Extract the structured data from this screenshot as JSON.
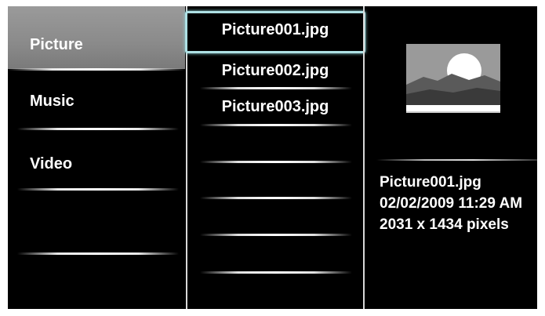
{
  "menu": {
    "items": [
      {
        "label": "Picture",
        "selected": true
      },
      {
        "label": "Music",
        "selected": false
      },
      {
        "label": "Video",
        "selected": false
      }
    ]
  },
  "files": {
    "items": [
      {
        "label": "Picture001.jpg",
        "focused": true
      },
      {
        "label": "Picture002.jpg",
        "focused": false
      },
      {
        "label": "Picture003.jpg",
        "focused": false
      }
    ]
  },
  "preview": {
    "thumbnail_icon": "landscape-thumbnail-icon",
    "filename": "Picture001.jpg",
    "datetime": "02/02/2009 11:29 AM",
    "dimensions": "2031 x 1434 pixels"
  },
  "colors": {
    "background": "#000000",
    "selected_menu": "#8a8a8a",
    "focus_border": "#aee0e4",
    "text": "#ffffff"
  }
}
